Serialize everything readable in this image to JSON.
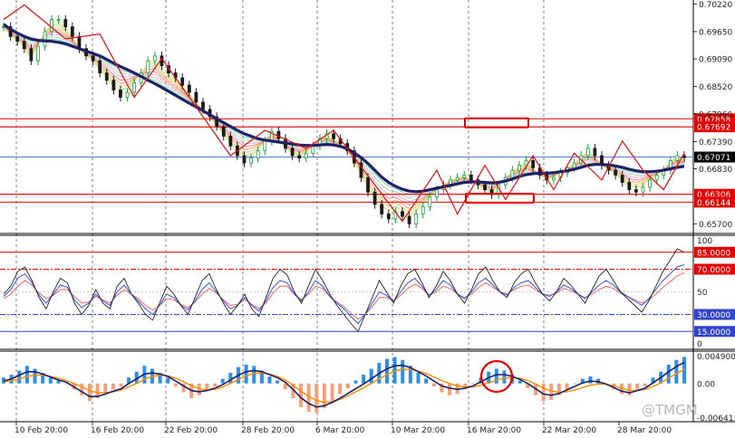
{
  "chart_data": {
    "type": "line",
    "colors": {
      "up_candle": "#1a9e3a",
      "down_candle": "#1a1a1a",
      "ma_main": "#1f2066",
      "level_line": "#e00000",
      "current_line": "#4466dd",
      "zigzag": "#e01010",
      "osc_fast": "#222222",
      "osc_k": "#3355dd",
      "osc_d": "#ee6666",
      "macd_pos": "#2e8fe6",
      "macd_neg": "#f5a07a",
      "macd_signal": "#ff8c00",
      "macd_line": "#1f2066"
    },
    "x_labels": [
      "10 Feb 20:00",
      "16 Feb 20:00",
      "22 Feb 20:00",
      "28 Feb 20:00",
      "6 Mar 20:00",
      "10 Mar 20:00",
      "16 Mar 20:00",
      "22 Mar 20:00",
      "28 Mar 20:00"
    ],
    "price_panel": {
      "ylim": [
        0.655,
        0.703
      ],
      "ticks": [
        "0.70220",
        "0.69650",
        "0.69090",
        "0.68520",
        "0.67960",
        "0.67390",
        "0.66830",
        "0.65700"
      ],
      "levels": [
        {
          "label": "0.67858",
          "value": 0.67858
        },
        {
          "label": "0.67692",
          "value": 0.67692
        },
        {
          "label": "0.66306",
          "value": 0.66306
        },
        {
          "label": "0.66144",
          "value": 0.66144
        }
      ],
      "current": {
        "label": "0.67071",
        "value": 0.67071
      },
      "close": [
        0.6975,
        0.6955,
        0.6945,
        0.693,
        0.6905,
        0.6935,
        0.6965,
        0.699,
        0.699,
        0.6975,
        0.6955,
        0.693,
        0.6915,
        0.6905,
        0.688,
        0.6865,
        0.6845,
        0.683,
        0.684,
        0.686,
        0.688,
        0.6905,
        0.6915,
        0.6895,
        0.688,
        0.687,
        0.6855,
        0.684,
        0.682,
        0.6805,
        0.679,
        0.677,
        0.675,
        0.673,
        0.671,
        0.6695,
        0.6705,
        0.672,
        0.674,
        0.676,
        0.6745,
        0.6725,
        0.671,
        0.6705,
        0.6715,
        0.673,
        0.6745,
        0.6755,
        0.6745,
        0.6735,
        0.672,
        0.6695,
        0.6665,
        0.6635,
        0.661,
        0.659,
        0.658,
        0.6595,
        0.6585,
        0.657,
        0.659,
        0.6605,
        0.6625,
        0.664,
        0.665,
        0.666,
        0.6665,
        0.667,
        0.666,
        0.665,
        0.664,
        0.663,
        0.665,
        0.6665,
        0.668,
        0.669,
        0.67,
        0.6685,
        0.667,
        0.666,
        0.6665,
        0.6675,
        0.6685,
        0.6695,
        0.671,
        0.6725,
        0.671,
        0.669,
        0.668,
        0.667,
        0.6655,
        0.664,
        0.6635,
        0.6645,
        0.666,
        0.667,
        0.668,
        0.67,
        0.671,
        0.6706
      ],
      "ma": [
        0.698,
        0.697,
        0.6962,
        0.6955,
        0.695,
        0.6947,
        0.6946,
        0.6945,
        0.6943,
        0.694,
        0.6935,
        0.693,
        0.6925,
        0.692,
        0.6915,
        0.6908,
        0.69,
        0.6893,
        0.6887,
        0.688,
        0.6873,
        0.6865,
        0.6858,
        0.685,
        0.6842,
        0.6834,
        0.6826,
        0.6818,
        0.681,
        0.6802,
        0.6794,
        0.6786,
        0.6778,
        0.677,
        0.6762,
        0.6755,
        0.675,
        0.6745,
        0.6742,
        0.674,
        0.6738,
        0.6736,
        0.6734,
        0.6732,
        0.6731,
        0.6731,
        0.6732,
        0.6733,
        0.6732,
        0.6729,
        0.6724,
        0.6716,
        0.6706,
        0.6694,
        0.668,
        0.6666,
        0.6655,
        0.6647,
        0.6641,
        0.6637,
        0.6636,
        0.6637,
        0.664,
        0.6643,
        0.6646,
        0.6649,
        0.6652,
        0.6655,
        0.6656,
        0.6656,
        0.6655,
        0.6654,
        0.6655,
        0.6658,
        0.6662,
        0.6667,
        0.6671,
        0.6673,
        0.6674,
        0.6674,
        0.6675,
        0.6677,
        0.6679,
        0.6682,
        0.6686,
        0.669,
        0.6692,
        0.6692,
        0.6691,
        0.6689,
        0.6686,
        0.6682,
        0.6679,
        0.6677,
        0.6677,
        0.6678,
        0.668,
        0.6683,
        0.6686,
        0.6688
      ],
      "zigzag": [
        [
          0,
          0.699
        ],
        [
          3,
          0.702
        ],
        [
          9,
          0.695
        ],
        [
          14,
          0.696
        ],
        [
          19,
          0.683
        ],
        [
          23,
          0.691
        ],
        [
          33,
          0.671
        ],
        [
          38,
          0.6762
        ],
        [
          44,
          0.6725
        ],
        [
          48,
          0.6762
        ],
        [
          58,
          0.6575
        ],
        [
          63,
          0.668
        ],
        [
          66,
          0.659
        ],
        [
          70,
          0.669
        ],
        [
          73,
          0.662
        ],
        [
          77,
          0.671
        ],
        [
          80,
          0.664
        ],
        [
          83,
          0.6715
        ],
        [
          87,
          0.666
        ],
        [
          90,
          0.674
        ],
        [
          93,
          0.668
        ],
        [
          96,
          0.664
        ],
        [
          99,
          0.6715
        ]
      ]
    },
    "osc_panel": {
      "ylim": [
        0,
        100
      ],
      "ticks": [
        "100",
        "50",
        "0"
      ],
      "levels": [
        {
          "label": "85.0000",
          "value": 85
        },
        {
          "label": "70.0000",
          "value": 70
        },
        {
          "label": "30.0000",
          "value": 30
        },
        {
          "label": "15.0000",
          "value": 15
        }
      ],
      "fast": [
        48,
        55,
        68,
        72,
        60,
        45,
        35,
        50,
        62,
        58,
        40,
        30,
        38,
        52,
        40,
        35,
        55,
        62,
        48,
        40,
        30,
        25,
        40,
        55,
        48,
        38,
        30,
        45,
        60,
        66,
        52,
        40,
        30,
        38,
        48,
        35,
        28,
        45,
        62,
        70,
        65,
        50,
        40,
        55,
        70,
        60,
        48,
        38,
        30,
        22,
        15,
        30,
        45,
        60,
        50,
        40,
        55,
        66,
        70,
        58,
        45,
        55,
        68,
        60,
        48,
        40,
        52,
        66,
        72,
        60,
        50,
        45,
        58,
        66,
        70,
        58,
        48,
        42,
        50,
        62,
        56,
        48,
        40,
        52,
        64,
        70,
        60,
        50,
        44,
        38,
        32,
        42,
        55,
        68,
        78,
        88,
        85
      ],
      "k": [
        46,
        52,
        62,
        66,
        58,
        47,
        40,
        48,
        56,
        54,
        43,
        36,
        40,
        48,
        42,
        38,
        50,
        56,
        48,
        42,
        35,
        30,
        38,
        48,
        45,
        38,
        34,
        42,
        52,
        58,
        50,
        42,
        35,
        38,
        45,
        38,
        33,
        42,
        54,
        60,
        58,
        48,
        42,
        50,
        60,
        55,
        46,
        40,
        35,
        28,
        22,
        30,
        40,
        50,
        47,
        42,
        50,
        58,
        62,
        55,
        47,
        52,
        60,
        56,
        48,
        44,
        50,
        58,
        62,
        56,
        50,
        47,
        54,
        58,
        60,
        54,
        48,
        46,
        50,
        56,
        53,
        48,
        44,
        50,
        56,
        60,
        56,
        50,
        46,
        42,
        38,
        44,
        52,
        60,
        66,
        72,
        74
      ],
      "d": [
        44,
        48,
        55,
        60,
        56,
        49,
        44,
        47,
        52,
        52,
        46,
        40,
        41,
        46,
        43,
        40,
        47,
        52,
        48,
        44,
        38,
        34,
        38,
        44,
        43,
        39,
        36,
        41,
        48,
        53,
        49,
        43,
        38,
        39,
        43,
        39,
        35,
        40,
        49,
        55,
        55,
        48,
        43,
        48,
        55,
        53,
        46,
        41,
        37,
        31,
        26,
        30,
        37,
        45,
        45,
        42,
        47,
        53,
        57,
        53,
        47,
        50,
        55,
        53,
        48,
        45,
        48,
        54,
        58,
        54,
        50,
        48,
        52,
        55,
        56,
        52,
        48,
        47,
        49,
        53,
        51,
        48,
        45,
        48,
        52,
        55,
        53,
        49,
        46,
        43,
        40,
        43,
        48,
        54,
        59,
        64,
        67
      ]
    },
    "macd_panel": {
      "ylim": [
        -0.0065,
        0.0055
      ],
      "ticks": [
        "0.0049007",
        "0.00",
        "-0.0064137"
      ],
      "hist": [
        0.001,
        0.0015,
        0.0022,
        0.003,
        0.0025,
        0.0018,
        0.001,
        0.0005,
        0.0,
        -0.001,
        -0.002,
        -0.003,
        -0.0025,
        -0.0018,
        -0.001,
        -0.0005,
        0.001,
        0.002,
        0.003,
        0.0025,
        0.0018,
        0.001,
        -0.0005,
        -0.0015,
        -0.0025,
        -0.002,
        -0.0012,
        -0.0005,
        0.0008,
        0.0018,
        0.0028,
        0.0032,
        0.003,
        0.0022,
        0.0012,
        0.0005,
        -0.001,
        -0.0025,
        -0.004,
        -0.0048,
        -0.005,
        -0.0042,
        -0.003,
        -0.0018,
        -0.0008,
        0.0005,
        0.0015,
        0.0025,
        0.0035,
        0.0042,
        0.0045,
        0.004,
        0.003,
        0.0018,
        0.0008,
        -0.0005,
        -0.0015,
        -0.002,
        -0.0018,
        -0.001,
        0.0,
        0.001,
        0.002,
        0.0025,
        0.0022,
        0.0015,
        0.0005,
        -0.0008,
        -0.002,
        -0.003,
        -0.0028,
        -0.002,
        -0.001,
        0.0,
        0.0008,
        0.0012,
        0.0008,
        0.0,
        -0.001,
        -0.0018,
        -0.002,
        -0.0012,
        -0.0005,
        0.001,
        0.002,
        0.0032,
        0.004,
        0.0045
      ],
      "signal": [
        0.0003,
        0.0005,
        0.0008,
        0.0012,
        0.0014,
        0.0014,
        0.0012,
        0.0009,
        0.0005,
        0.0,
        -0.0006,
        -0.0012,
        -0.0016,
        -0.0016,
        -0.0014,
        -0.0011,
        -0.0006,
        0.0,
        0.0007,
        0.0012,
        0.0014,
        0.0013,
        0.0009,
        0.0003,
        -0.0004,
        -0.0009,
        -0.0011,
        -0.001,
        -0.0006,
        0.0,
        0.0007,
        0.0013,
        0.0017,
        0.0018,
        0.0016,
        0.0012,
        0.0006,
        -0.0003,
        -0.0013,
        -0.0022,
        -0.0029,
        -0.0032,
        -0.0031,
        -0.0027,
        -0.0021,
        -0.0014,
        -0.0007,
        0.0,
        0.0008,
        0.0015,
        0.0021,
        0.0024,
        0.0024,
        0.0021,
        0.0017,
        0.0011,
        0.0005,
        0.0,
        -0.0004,
        -0.0006,
        -0.0006,
        -0.0003,
        0.0001,
        0.0006,
        0.0009,
        0.001,
        0.0009,
        0.0005,
        -0.0001,
        -0.0008,
        -0.0013,
        -0.0015,
        -0.0014,
        -0.0011,
        -0.0007,
        -0.0003,
        -0.0001,
        -0.0001,
        -0.0004,
        -0.0008,
        -0.0012,
        -0.0012,
        -0.001,
        -0.0005,
        0.0001,
        0.0009,
        0.0017,
        0.0024
      ],
      "line": [
        0.0004,
        0.0008,
        0.0014,
        0.002,
        0.002,
        0.0016,
        0.0011,
        0.0006,
        0.0002,
        -0.0006,
        -0.0014,
        -0.0022,
        -0.0022,
        -0.0018,
        -0.0013,
        -0.0009,
        0.0,
        0.0008,
        0.0016,
        0.0018,
        0.0016,
        0.0012,
        0.0004,
        -0.0004,
        -0.0012,
        -0.0014,
        -0.0012,
        -0.0008,
        -0.0002,
        0.0006,
        0.0014,
        0.002,
        0.0022,
        0.002,
        0.0015,
        0.001,
        0.0002,
        -0.001,
        -0.0024,
        -0.0034,
        -0.004,
        -0.0038,
        -0.0032,
        -0.0025,
        -0.0017,
        -0.0009,
        -0.0001,
        0.0008,
        0.0017,
        0.0025,
        0.003,
        0.0031,
        0.0027,
        0.002,
        0.0013,
        0.0004,
        -0.0004,
        -0.0008,
        -0.001,
        -0.0008,
        -0.0004,
        0.0003,
        0.001,
        0.0015,
        0.0015,
        0.0012,
        0.0007,
        0.0,
        -0.0009,
        -0.0018,
        -0.002,
        -0.0017,
        -0.0011,
        -0.0005,
        0.0001,
        0.0004,
        0.0003,
        -0.0001,
        -0.0007,
        -0.0013,
        -0.0016,
        -0.0012,
        -0.0008,
        0.0001,
        0.001,
        0.002,
        0.0029,
        0.0036
      ]
    },
    "watermark": "@TMGM"
  }
}
